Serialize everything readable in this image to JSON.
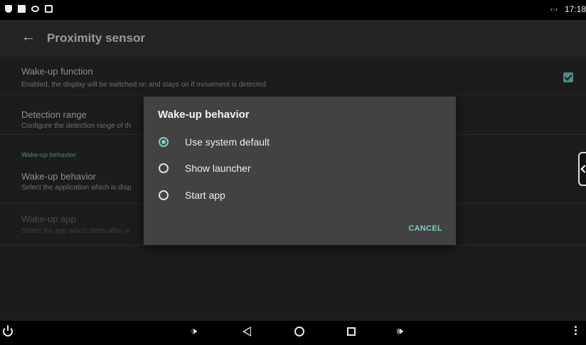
{
  "status_bar": {
    "left_icons": [
      "shield-icon",
      "square-icon",
      "eye-icon",
      "screenshot-icon"
    ],
    "network_icon": "‹·›",
    "time": "17:18"
  },
  "toolbar": {
    "back_icon": "←",
    "title": "Proximity sensor"
  },
  "settings": {
    "wakeup_function": {
      "title": "Wake-up function",
      "summary": "Enabled, the display will be switched on and stays on if movement is detected",
      "checked": true
    },
    "detection_range": {
      "title": "Detection range",
      "summary": "Configure the detection range of th"
    },
    "category_label": "Wake-up behavior",
    "wakeup_behavior": {
      "title": "Wake-up behavior",
      "summary": "Select the application which is disp"
    },
    "wakeup_app": {
      "title": "Wake-up app",
      "summary": "Select the app which starts after w",
      "enabled": false
    }
  },
  "dialog": {
    "title": "Wake-up behavior",
    "options": [
      {
        "label": "Use system default",
        "selected": true
      },
      {
        "label": "Show launcher",
        "selected": false
      },
      {
        "label": "Start app",
        "selected": false
      }
    ],
    "cancel_label": "CANCEL"
  },
  "colors": {
    "accent": "#80cbc4",
    "dialog_bg": "#424242",
    "toolbar_bg": "#242424",
    "list_bg": "#1c1c1c"
  },
  "nav_bar": {
    "left_volume_icon": "🕩",
    "right_volume_icon": "🕪"
  }
}
